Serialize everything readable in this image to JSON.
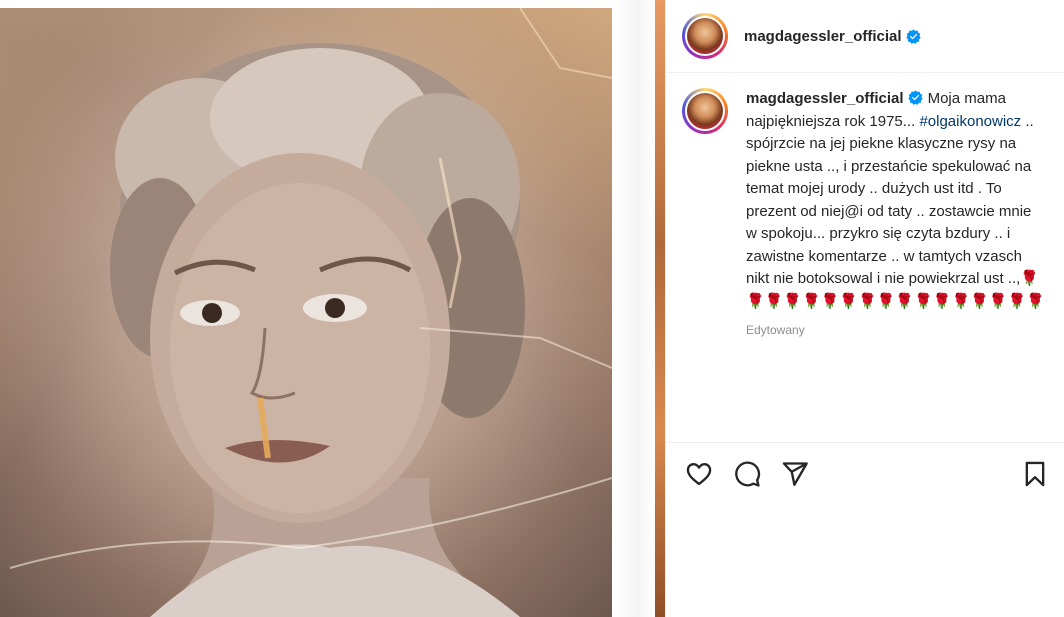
{
  "post": {
    "username": "magdagessler_official",
    "verified": true
  },
  "caption": {
    "username": "magdagessler_official",
    "text_before_hashtag": "Moja mama najpiękniejsza rok 1975... ",
    "hashtag": "#olgaikonowicz",
    "text_after_hashtag": " .. spójrzcie na jej piekne klasyczne rysy na piekne usta .., i przestańcie spekulować na temat mojej urody .. dużych ust itd . To prezent od niej@i od taty .. zostawcie mnie w spokoju... przykro się czyta bzdury .. i zawistne komentarze .. w tamtych vzasch nikt nie botoksowal i nie powiekrzal ust ..,",
    "emojis": "🌹🌹🌹🌹🌹🌹🌹🌹🌹🌹🌹🌹🌹🌹🌹🌹🌹",
    "edited_label": "Edytowany"
  },
  "icons": {
    "like": "heart-icon",
    "comment": "comment-icon",
    "share": "share-icon",
    "save": "bookmark-icon",
    "verified": "verified-badge-icon"
  },
  "colors": {
    "verified_badge": "#0095f6",
    "hashtag": "#00376b",
    "muted": "#8e8e8e",
    "divider": "#efefef"
  }
}
